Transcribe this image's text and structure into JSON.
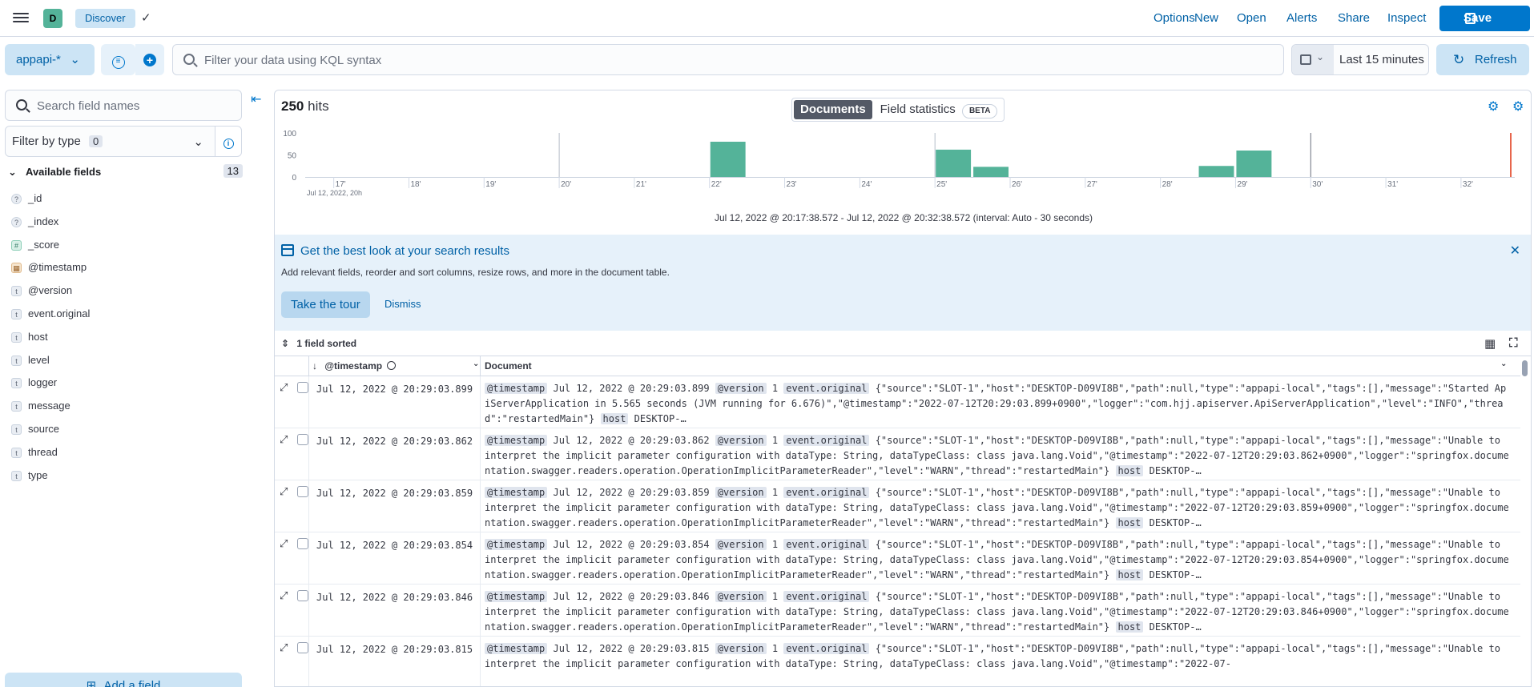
{
  "header": {
    "space_initial": "D",
    "breadcrumb": "Discover",
    "nav": [
      "Options",
      "New",
      "Open",
      "Alerts",
      "Share",
      "Inspect"
    ],
    "save_label": "Save"
  },
  "query_bar": {
    "data_view": "appapi-*",
    "kql_placeholder": "Filter your data using KQL syntax",
    "time_range": "Last 15 minutes",
    "refresh_label": "Refresh"
  },
  "sidebar": {
    "search_placeholder": "Search field names",
    "filter_label": "Filter by type",
    "filter_count": "0",
    "available_label": "Available fields",
    "available_count": "13",
    "fields": [
      {
        "name": "_id",
        "type": "q"
      },
      {
        "name": "_index",
        "type": "q"
      },
      {
        "name": "_score",
        "type": "n"
      },
      {
        "name": "@timestamp",
        "type": "d"
      },
      {
        "name": "@version",
        "type": "t"
      },
      {
        "name": "event.original",
        "type": "t"
      },
      {
        "name": "host",
        "type": "t"
      },
      {
        "name": "level",
        "type": "t"
      },
      {
        "name": "logger",
        "type": "t"
      },
      {
        "name": "message",
        "type": "t"
      },
      {
        "name": "source",
        "type": "t"
      },
      {
        "name": "thread",
        "type": "t"
      },
      {
        "name": "type",
        "type": "t"
      }
    ],
    "add_field_label": "Add a field"
  },
  "main": {
    "hits_count": "250",
    "hits_label": "hits",
    "tab_documents": "Documents",
    "tab_field_stats": "Field statistics",
    "beta": "BETA",
    "range_text": "Jul 12, 2022 @ 20:17:38.572 - Jul 12, 2022 @ 20:32:38.572 (interval: Auto - 30 seconds)"
  },
  "chart_data": {
    "type": "bar",
    "x_tick_labels": [
      "17'",
      "18'",
      "19'",
      "20'",
      "21'",
      "22'",
      "23'",
      "24'",
      "25'",
      "26'",
      "27'",
      "28'",
      "29'",
      "30'",
      "31'",
      "32'"
    ],
    "x_sublabel": "Jul 12, 2022, 20h",
    "y_ticks": [
      0,
      50,
      100
    ],
    "ylim": [
      0,
      100
    ],
    "bars": [
      {
        "minute": 22.0,
        "value": 80
      },
      {
        "minute": 25.0,
        "value": 62
      },
      {
        "minute": 25.5,
        "value": 23
      },
      {
        "minute": 28.5,
        "value": 25
      },
      {
        "minute": 29.0,
        "value": 60
      }
    ],
    "bar_color": "#54b399"
  },
  "callout": {
    "title": "Get the best look at your search results",
    "description": "Add relevant fields, reorder and sort columns, resize rows, and more in the document table.",
    "tour_label": "Take the tour",
    "dismiss_label": "Dismiss"
  },
  "table": {
    "sort_label": "1 field sorted",
    "col_timestamp": "@timestamp",
    "col_document": "Document",
    "rows": [
      {
        "ts": "Jul 12, 2022 @ 20:29:03.899",
        "doc_ts": "Jul 12, 2022 @ 20:29:03.899",
        "ver": "1",
        "orig": "{\"source\":\"SLOT-1\",\"host\":\"DESKTOP-D09VI8B\",\"path\":null,\"type\":\"appapi-local\",\"tags\":[],\"message\":\"Started ApiServerApplication in 5.565 seconds (JVM running for 6.676)\",\"@timestamp\":\"2022-07-12T20:29:03.899+0900\",\"logger\":\"com.hjj.apiserver.ApiServerApplication\",\"level\":\"INFO\",\"thread\":\"restartedMain\"}",
        "host": "DESKTOP-…"
      },
      {
        "ts": "Jul 12, 2022 @ 20:29:03.862",
        "doc_ts": "Jul 12, 2022 @ 20:29:03.862",
        "ver": "1",
        "orig": "{\"source\":\"SLOT-1\",\"host\":\"DESKTOP-D09VI8B\",\"path\":null,\"type\":\"appapi-local\",\"tags\":[],\"message\":\"Unable to interpret the implicit parameter configuration with dataType: String, dataTypeClass: class java.lang.Void\",\"@timestamp\":\"2022-07-12T20:29:03.862+0900\",\"logger\":\"springfox.documentation.swagger.readers.operation.OperationImplicitParameterReader\",\"level\":\"WARN\",\"thread\":\"restartedMain\"}",
        "host": "DESKTOP-…"
      },
      {
        "ts": "Jul 12, 2022 @ 20:29:03.859",
        "doc_ts": "Jul 12, 2022 @ 20:29:03.859",
        "ver": "1",
        "orig": "{\"source\":\"SLOT-1\",\"host\":\"DESKTOP-D09VI8B\",\"path\":null,\"type\":\"appapi-local\",\"tags\":[],\"message\":\"Unable to interpret the implicit parameter configuration with dataType: String, dataTypeClass: class java.lang.Void\",\"@timestamp\":\"2022-07-12T20:29:03.859+0900\",\"logger\":\"springfox.documentation.swagger.readers.operation.OperationImplicitParameterReader\",\"level\":\"WARN\",\"thread\":\"restartedMain\"}",
        "host": "DESKTOP-…"
      },
      {
        "ts": "Jul 12, 2022 @ 20:29:03.854",
        "doc_ts": "Jul 12, 2022 @ 20:29:03.854",
        "ver": "1",
        "orig": "{\"source\":\"SLOT-1\",\"host\":\"DESKTOP-D09VI8B\",\"path\":null,\"type\":\"appapi-local\",\"tags\":[],\"message\":\"Unable to interpret the implicit parameter configuration with dataType: String, dataTypeClass: class java.lang.Void\",\"@timestamp\":\"2022-07-12T20:29:03.854+0900\",\"logger\":\"springfox.documentation.swagger.readers.operation.OperationImplicitParameterReader\",\"level\":\"WARN\",\"thread\":\"restartedMain\"}",
        "host": "DESKTOP-…"
      },
      {
        "ts": "Jul 12, 2022 @ 20:29:03.846",
        "doc_ts": "Jul 12, 2022 @ 20:29:03.846",
        "ver": "1",
        "orig": "{\"source\":\"SLOT-1\",\"host\":\"DESKTOP-D09VI8B\",\"path\":null,\"type\":\"appapi-local\",\"tags\":[],\"message\":\"Unable to interpret the implicit parameter configuration with dataType: String, dataTypeClass: class java.lang.Void\",\"@timestamp\":\"2022-07-12T20:29:03.846+0900\",\"logger\":\"springfox.documentation.swagger.readers.operation.OperationImplicitParameterReader\",\"level\":\"WARN\",\"thread\":\"restartedMain\"}",
        "host": "DESKTOP-…"
      },
      {
        "ts": "Jul 12, 2022 @ 20:29:03.815",
        "doc_ts": "Jul 12, 2022 @ 20:29:03.815",
        "ver": "1",
        "orig": "{\"source\":\"SLOT-1\",\"host\":\"DESKTOP-D09VI8B\",\"path\":null,\"type\":\"appapi-local\",\"tags\":[],\"message\":\"Unable to interpret the implicit parameter configuration with dataType: String, dataTypeClass: class java.lang.Void\",\"@timestamp\":\"2022-07-",
        "host": ""
      }
    ]
  }
}
